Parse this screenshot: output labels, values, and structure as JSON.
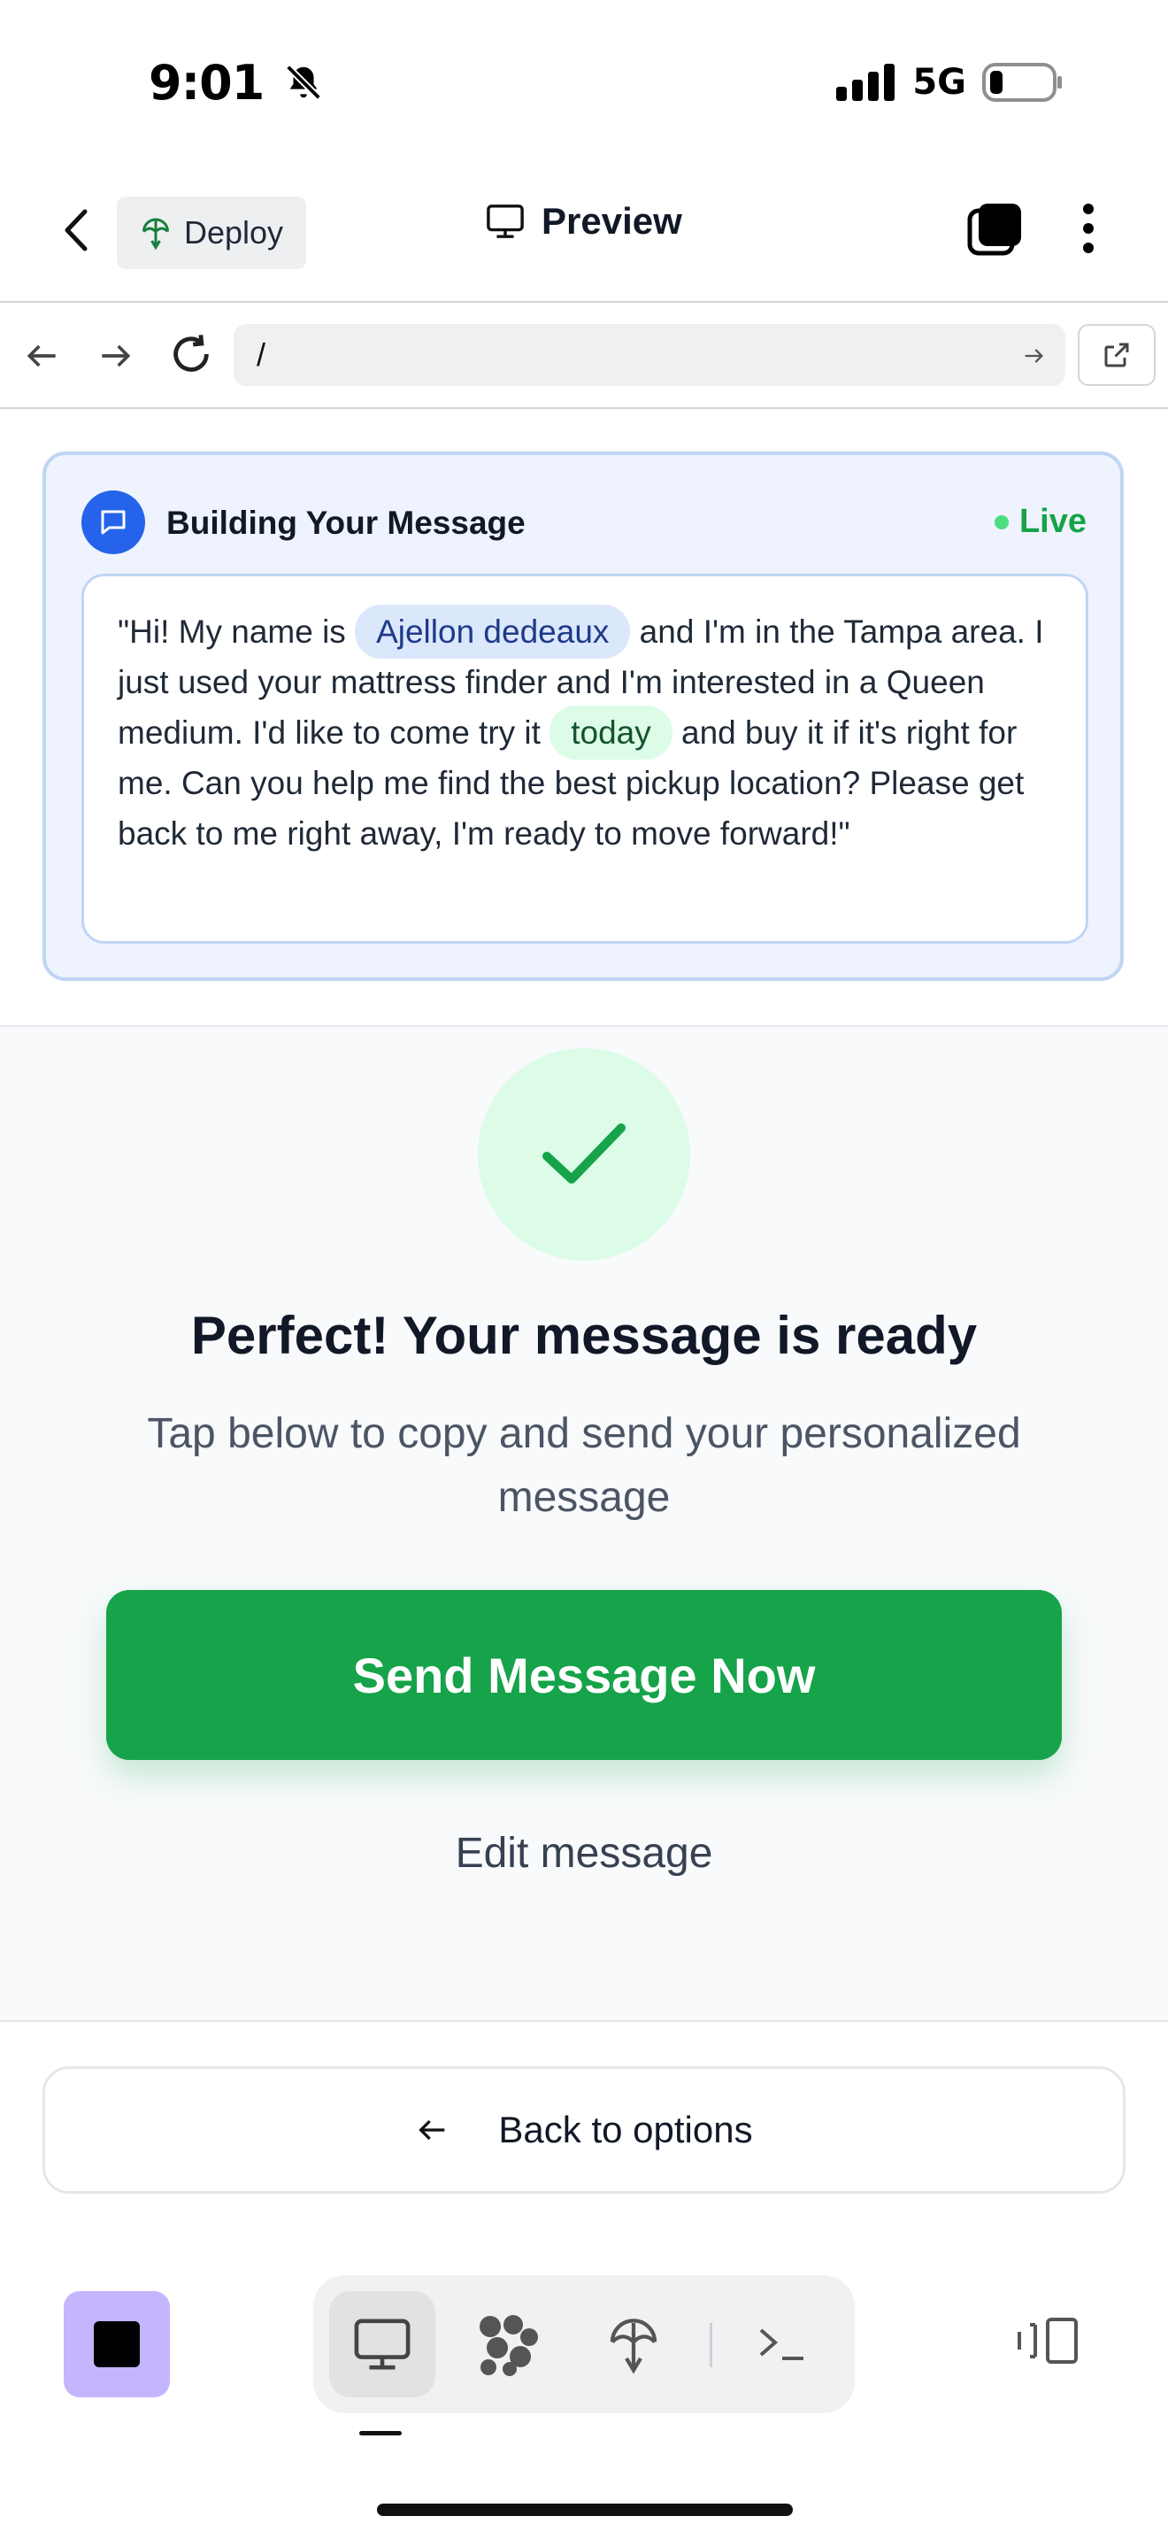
{
  "status_bar": {
    "time": "9:01",
    "network": "5G"
  },
  "header": {
    "deploy_label": "Deploy",
    "title": "Preview"
  },
  "url_bar": {
    "path": "/"
  },
  "message_card": {
    "title": "Building Your Message",
    "live_label": "Live",
    "message": {
      "part1": "\"Hi! My name is ",
      "name": "Ajellon dedeaux",
      "part2": " and I'm in the Tampa area. I just used your mattress finder and I'm interested in a Queen medium. I'd like to come try it ",
      "when": "today",
      "part3": " and buy it if it's right for me. Can you help me find the best pickup location? Please get back to me right away, I'm ready to move forward!\""
    }
  },
  "success": {
    "title": "Perfect! Your message is ready",
    "subtitle": "Tap below to copy and send your personalized message",
    "send_label": "Send Message Now",
    "edit_label": "Edit message"
  },
  "footer": {
    "back_label": "Back to options"
  },
  "colors": {
    "accent_green": "#16a34a",
    "accent_blue": "#2563eb",
    "stop_purple": "#c4b5fd"
  }
}
